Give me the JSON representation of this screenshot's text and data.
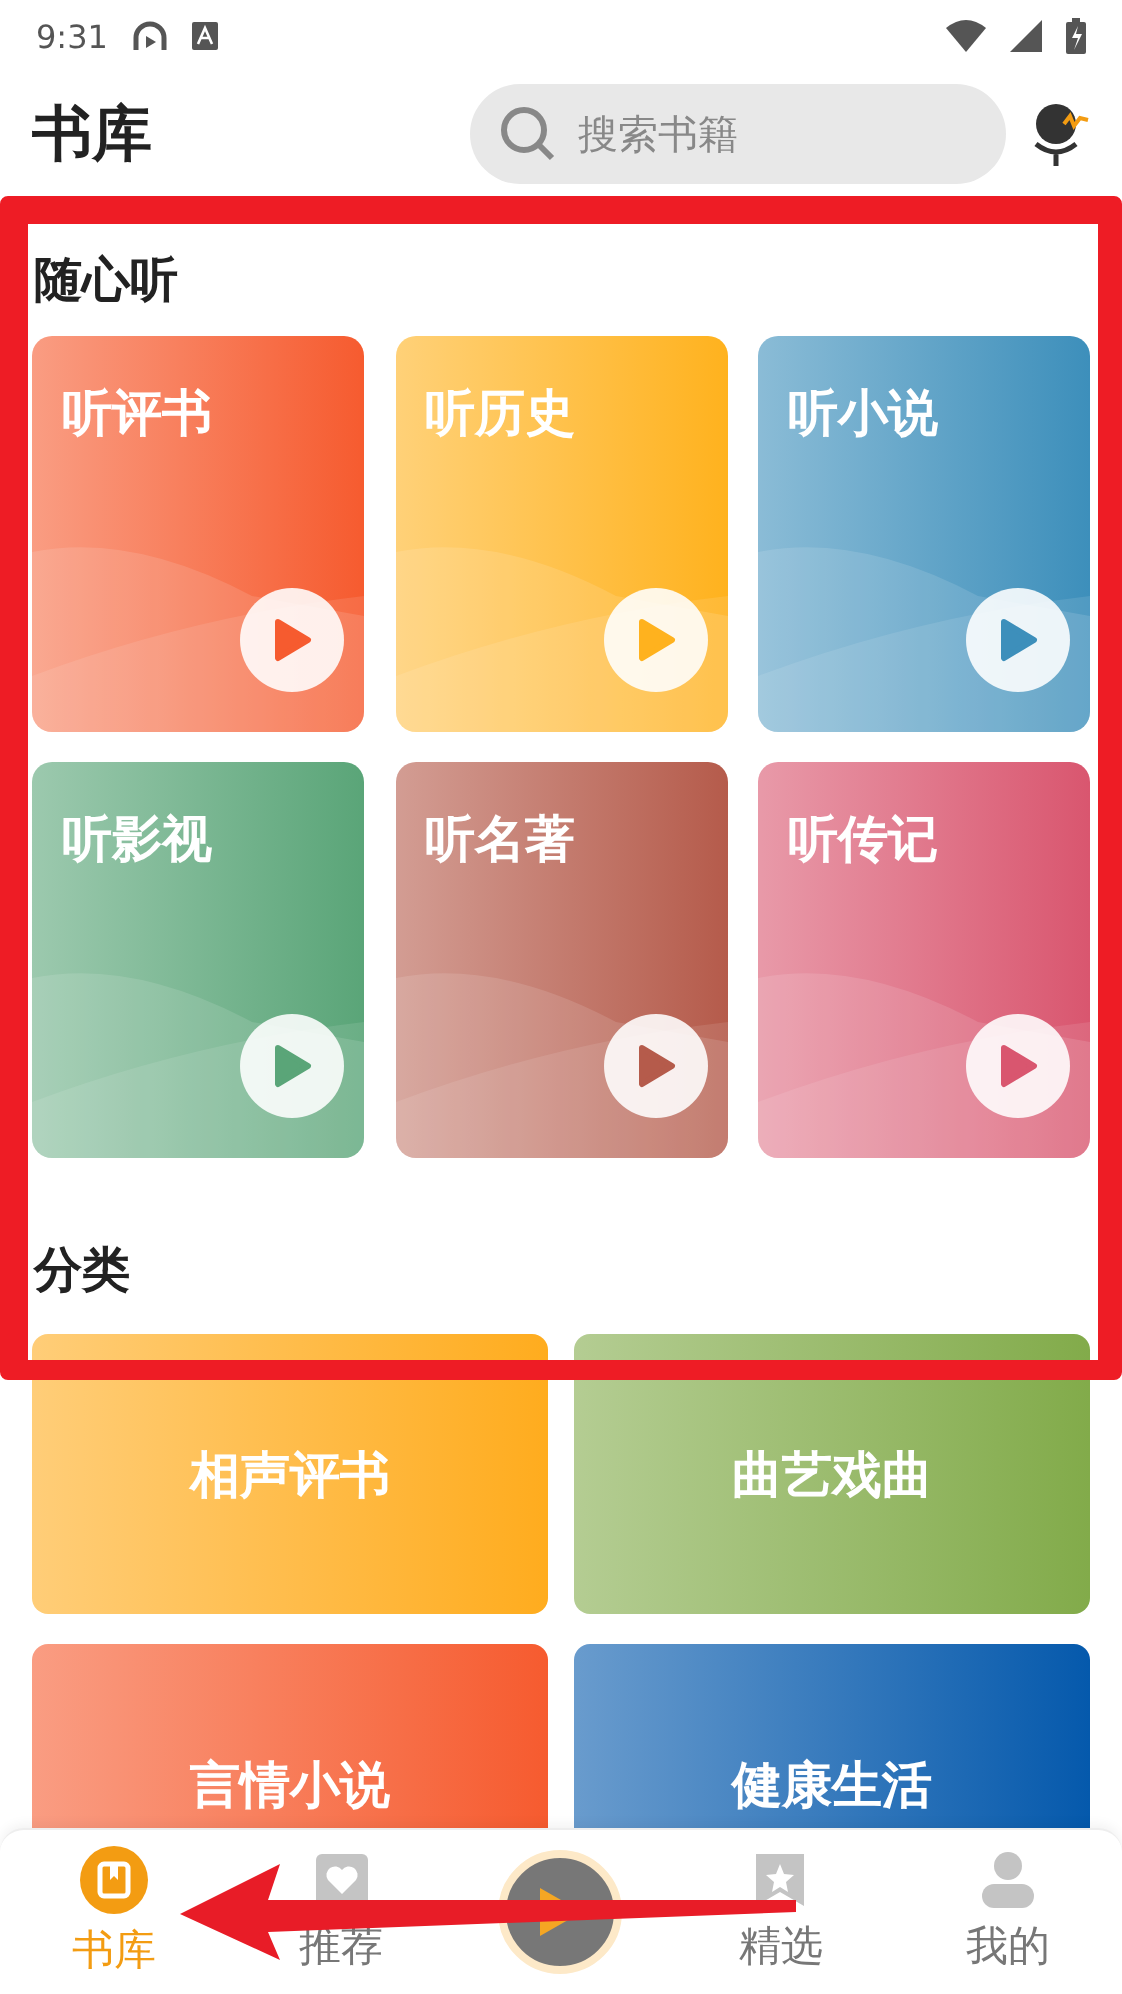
{
  "status_bar": {
    "time": "9:31"
  },
  "header": {
    "title": "书库",
    "search": {
      "placeholder": "搜索书籍"
    }
  },
  "listen": {
    "title": "随心听",
    "cards": [
      {
        "label": "听评书",
        "color": "#f65b2f"
      },
      {
        "label": "听历史",
        "color": "#ffb21e"
      },
      {
        "label": "听小说",
        "color": "#3d8fbb"
      },
      {
        "label": "听影视",
        "color": "#5aa578"
      },
      {
        "label": "听名著",
        "color": "#b55b4b"
      },
      {
        "label": "听传记",
        "color": "#d9566f"
      }
    ]
  },
  "categories": {
    "title": "分类",
    "cards": [
      {
        "label": "相声评书",
        "color": "#ffac1e"
      },
      {
        "label": "曲艺戏曲",
        "color": "#82ab4a"
      },
      {
        "label": "言情小说",
        "color": "#f65b2f"
      },
      {
        "label": "健康生活",
        "color": "#0559ac"
      }
    ]
  },
  "nav": {
    "items": [
      {
        "kind": "tab",
        "label": "书库",
        "selected": true
      },
      {
        "kind": "tab",
        "label": "推荐",
        "selected": false
      },
      {
        "kind": "player"
      },
      {
        "kind": "tab",
        "label": "精选",
        "selected": false
      },
      {
        "kind": "tab",
        "label": "我的",
        "selected": false
      }
    ]
  }
}
